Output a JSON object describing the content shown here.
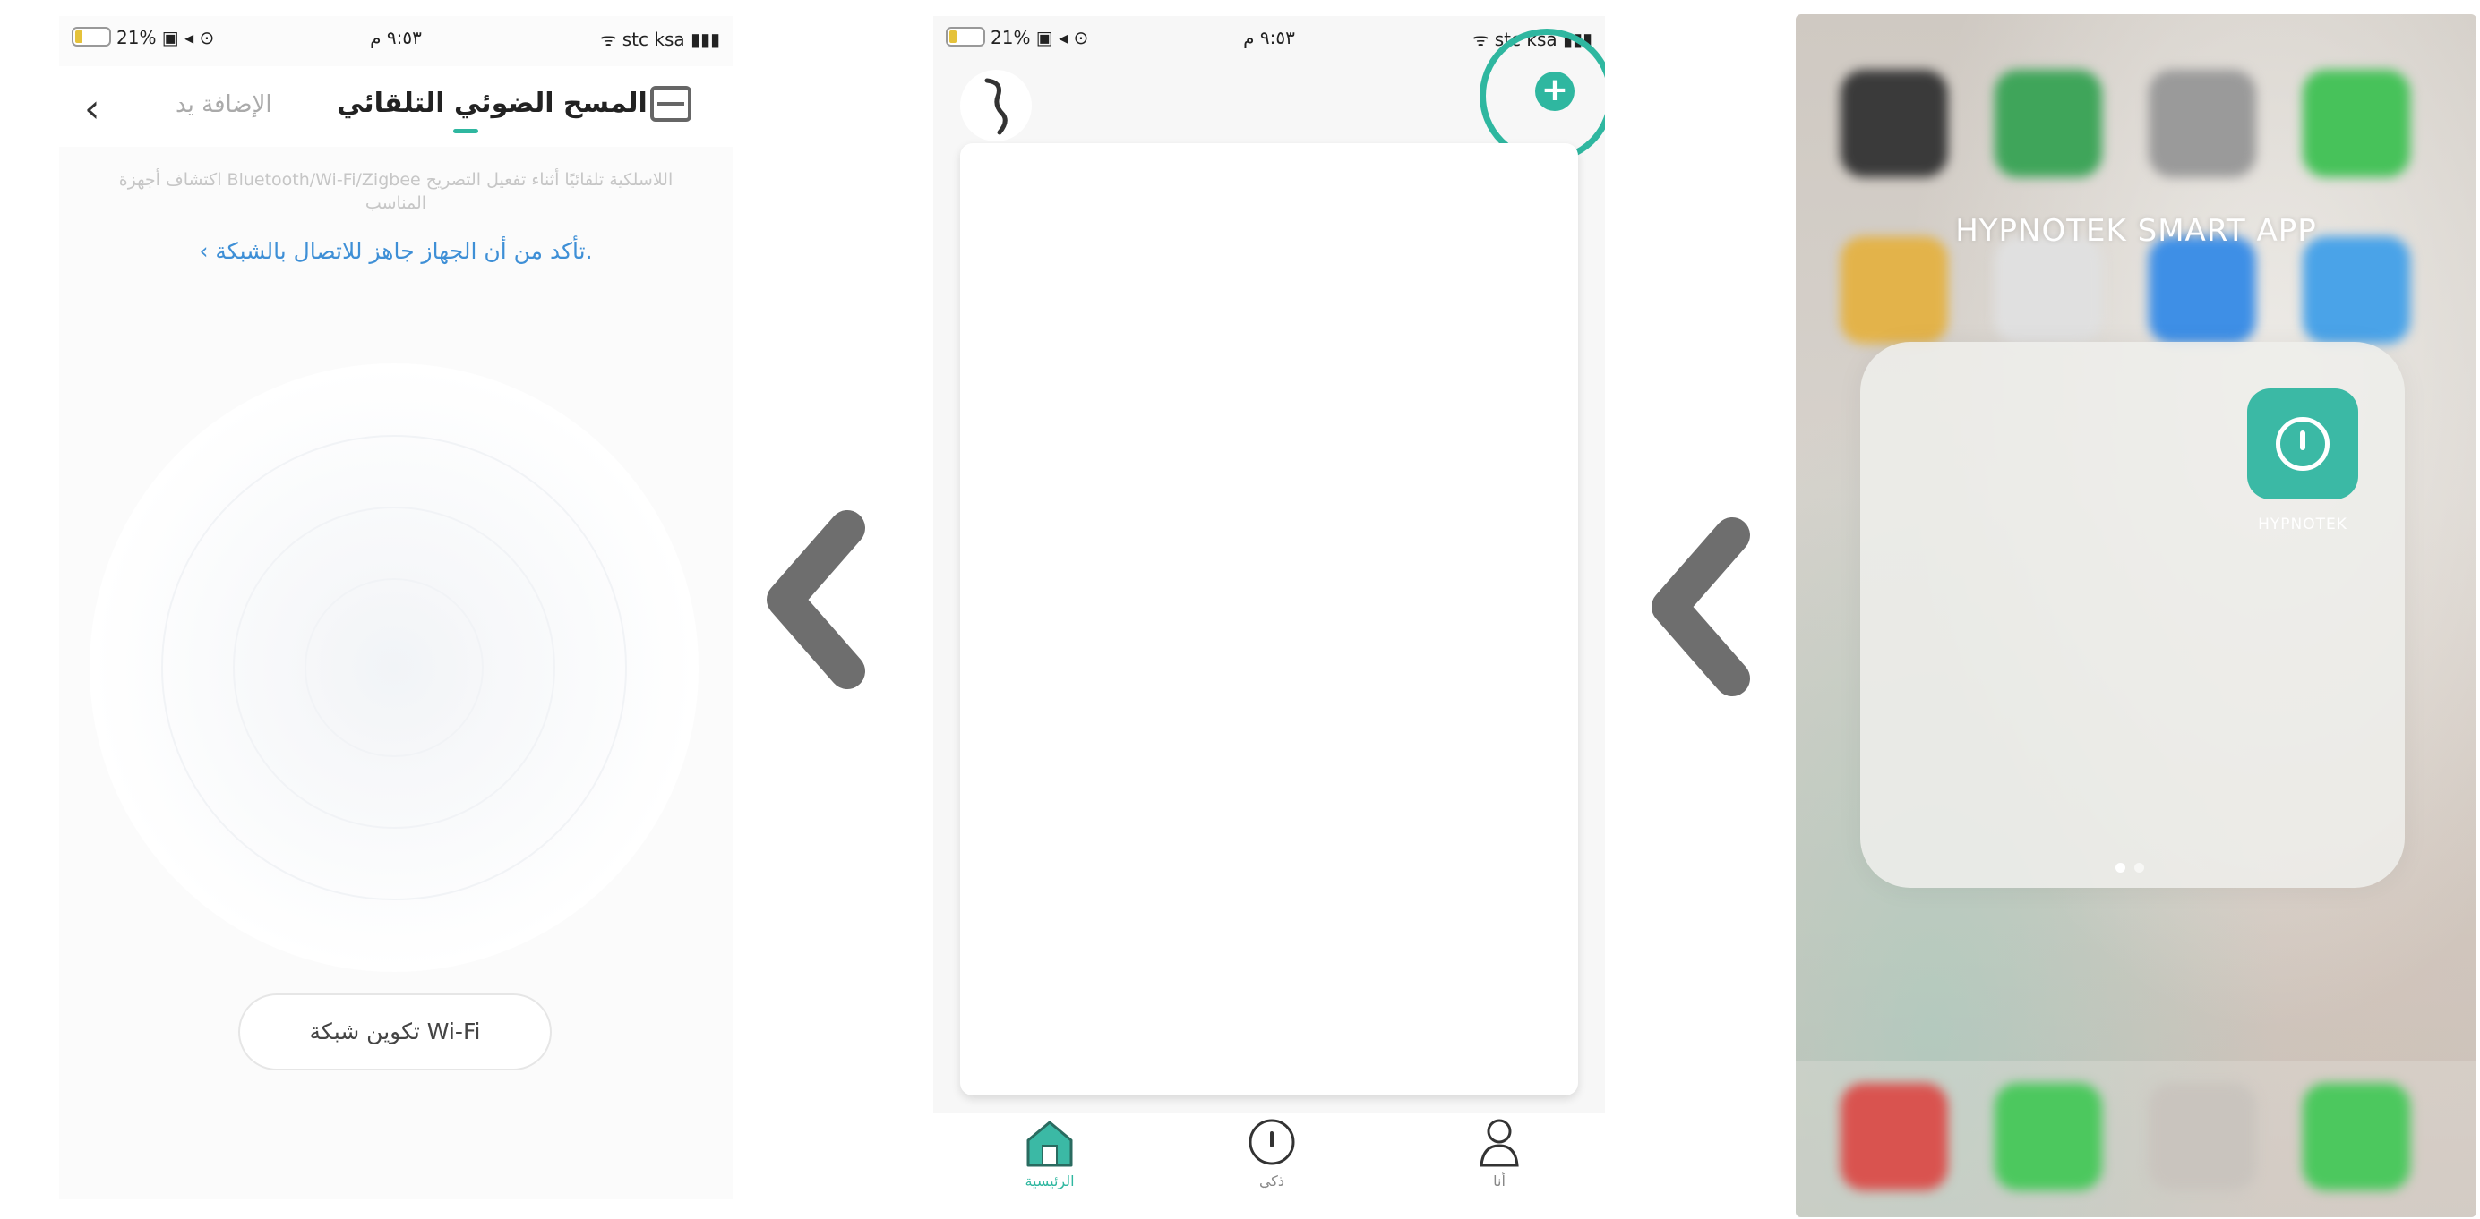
{
  "colors": {
    "accent": "#2fb7a0",
    "link": "#3e8fd6",
    "arrow": "#6e6e6e",
    "app_tile": "#3bb9a5"
  },
  "panel_scan": {
    "status": {
      "left": "21% ▣ ◂ ⊙",
      "time": "٩:٥٣ م",
      "right": "ᯤ stc ksa ▮▮▮"
    },
    "scan_icon": "scan-icon",
    "tab_auto": "المسح الضوئي التلقائي",
    "tab_manual": "الإضافة يد",
    "back_icon": "‹",
    "hint": "اكتشاف أجهزة Bluetooth/Wi-Fi/Zigbee اللاسلكية تلقائيًا أثناء تفعيل التصريح المناسب",
    "ready_link": "‹ تأكد من أن الجهاز جاهز للاتصال بالشبكة.",
    "wifi_button": "تكوين شبكة Wi-Fi"
  },
  "panel_home": {
    "status": {
      "left": "21% ▣ ◂ ⊙",
      "time": "٩:٥٣ م",
      "right": "ᯤ stc ksa ▮▮▮"
    },
    "add_icon": "+",
    "tabs": [
      {
        "label": "الرئيسية",
        "icon": "home-icon"
      },
      {
        "label": "ذكي",
        "icon": "smart-icon"
      },
      {
        "label": "أنا",
        "icon": "me-icon"
      }
    ]
  },
  "panel_springboard": {
    "folder_title": "HYPNOTEK SMART APP",
    "app_label": "HYPNOTEK"
  }
}
